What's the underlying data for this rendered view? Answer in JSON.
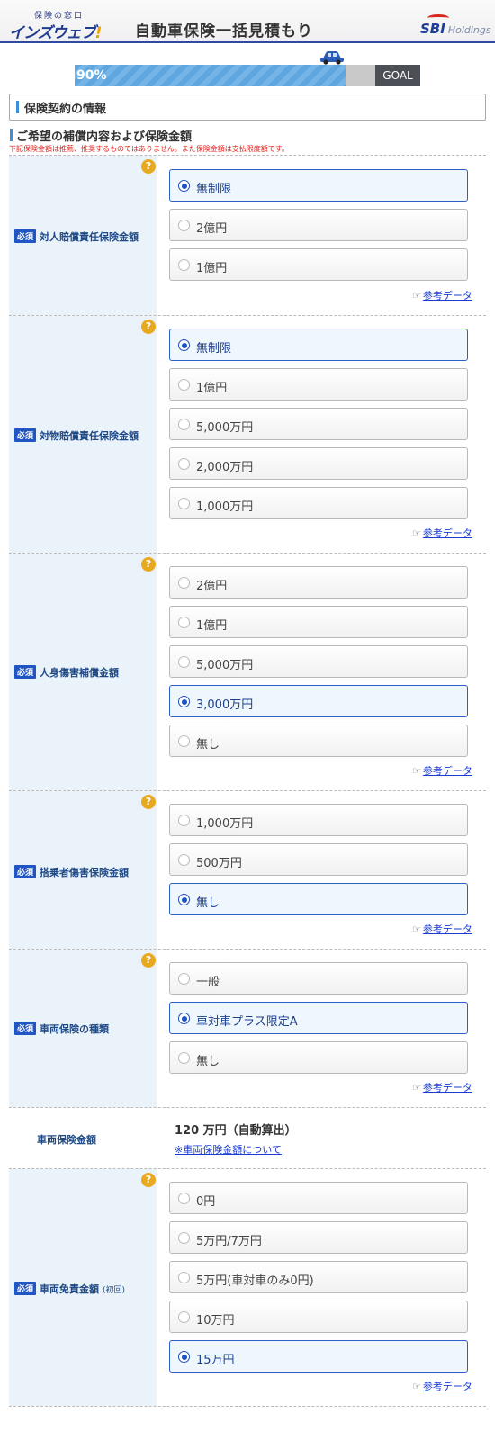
{
  "header": {
    "logo_sub": "保険の窓口",
    "logo_main": "インズウェブ",
    "logo_bang": "!",
    "title": "自動車保険一括見積もり",
    "brand_mark": "SBI",
    "brand_sub": "Holdings"
  },
  "progress": {
    "percent_label": "90%",
    "fraction": 0.9,
    "goal_label": "GOAL"
  },
  "section_title": "保険契約の情報",
  "subsection_title": "ご希望の補償内容および保険金額",
  "notice": "下記保険金額は推薦、推奨するものではありません。また保険金額は支払限度額です。",
  "required_badge": "必須",
  "help_icon": "?",
  "ref_link": "参考データ",
  "rows": [
    {
      "label": "対人賠償責任保険金額",
      "options": [
        {
          "label": "無制限",
          "selected": true
        },
        {
          "label": "2億円",
          "selected": false
        },
        {
          "label": "1億円",
          "selected": false
        }
      ]
    },
    {
      "label": "対物賠償責任保険金額",
      "options": [
        {
          "label": "無制限",
          "selected": true
        },
        {
          "label": "1億円",
          "selected": false
        },
        {
          "label": "5,000万円",
          "selected": false
        },
        {
          "label": "2,000万円",
          "selected": false
        },
        {
          "label": "1,000万円",
          "selected": false
        }
      ]
    },
    {
      "label": "人身傷害補償金額",
      "options": [
        {
          "label": "2億円",
          "selected": false
        },
        {
          "label": "1億円",
          "selected": false
        },
        {
          "label": "5,000万円",
          "selected": false
        },
        {
          "label": "3,000万円",
          "selected": true
        },
        {
          "label": "無し",
          "selected": false
        }
      ]
    },
    {
      "label": "搭乗者傷害保険金額",
      "options": [
        {
          "label": "1,000万円",
          "selected": false
        },
        {
          "label": "500万円",
          "selected": false
        },
        {
          "label": "無し",
          "selected": true
        }
      ]
    },
    {
      "label": "車両保険の種類",
      "options": [
        {
          "label": "一般",
          "selected": false
        },
        {
          "label": "車対車プラス限定A",
          "selected": true
        },
        {
          "label": "無し",
          "selected": false
        }
      ]
    },
    {
      "label": "車両免責金額",
      "label_note": "(初回)",
      "options": [
        {
          "label": "0円",
          "selected": false
        },
        {
          "label": "5万円/7万円",
          "selected": false
        },
        {
          "label": "5万円(車対車のみ0円)",
          "selected": false
        },
        {
          "label": "10万円",
          "selected": false
        },
        {
          "label": "15万円",
          "selected": true
        }
      ]
    }
  ],
  "vehicle_amount": {
    "label": "車両保険金額",
    "value": "120 万円（自動算出）",
    "link": "※車両保険金額について"
  },
  "colors": {
    "accent": "#2d5fc4",
    "label_bg": "#eaf2fa",
    "help": "#e9a91e",
    "notice": "#e0231d"
  }
}
